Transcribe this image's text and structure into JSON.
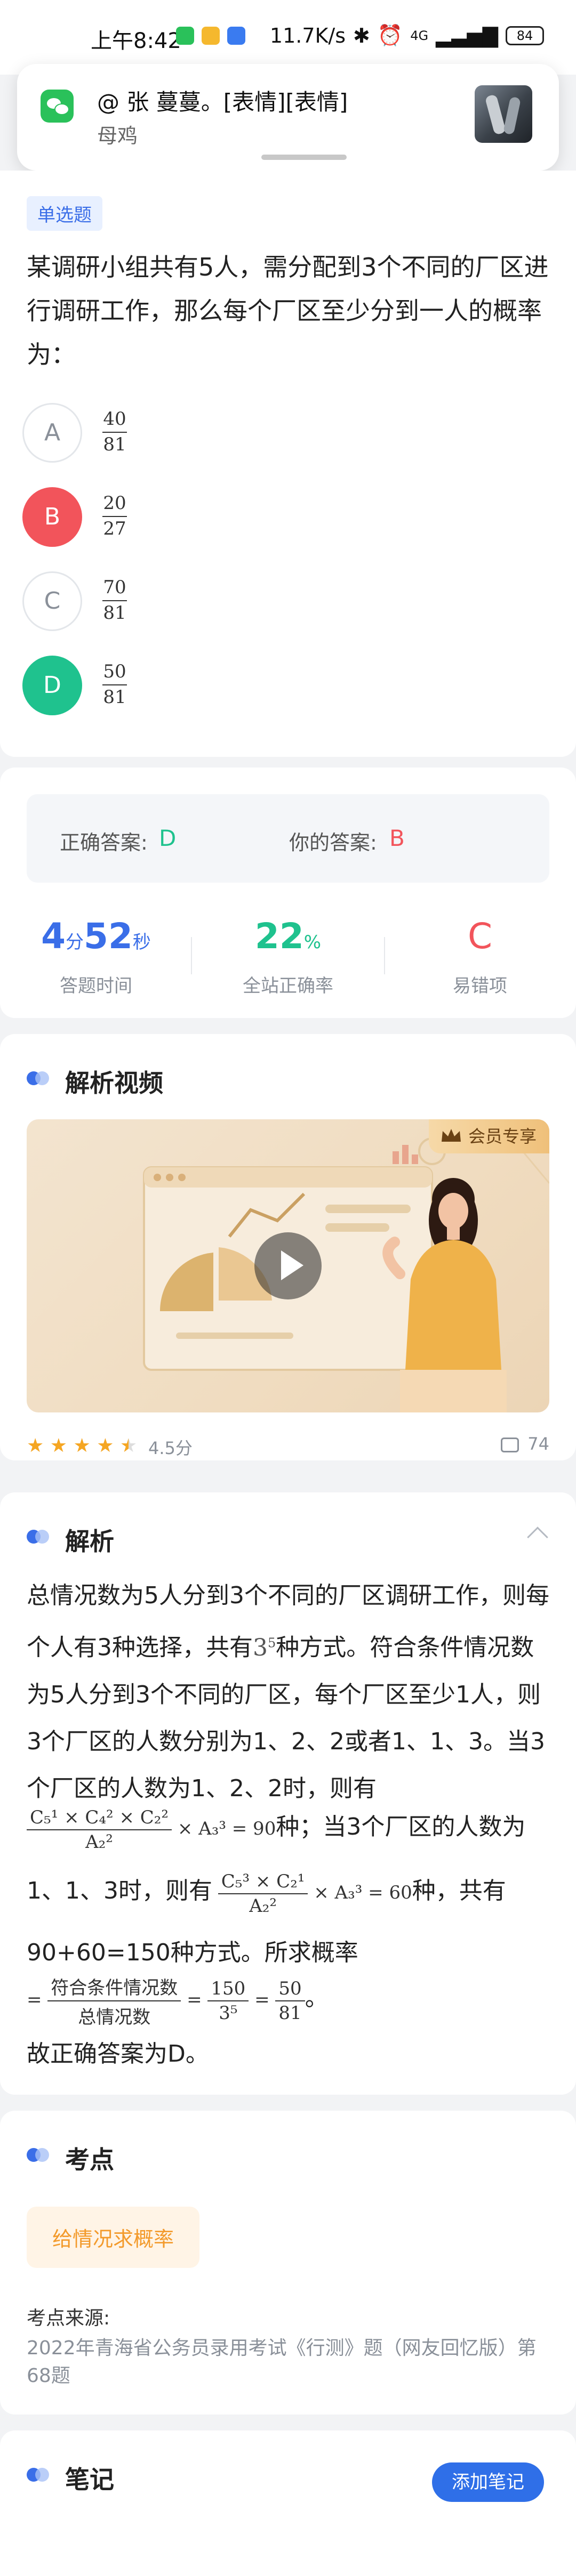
{
  "status_bar": {
    "time": "上午8:42",
    "net_speed": "11.7K/s",
    "network": "4G",
    "battery": "84"
  },
  "notification": {
    "app_icon": "wechat-icon",
    "title": "@ 张 蔓蔓。[表情][表情]",
    "body": "母鸡"
  },
  "question": {
    "type_badge": "单选题",
    "text": "某调研小组共有5人，需分配到3个不同的厂区进行调研工作，那么每个厂区至少分到一人的概率为：",
    "options": [
      {
        "letter": "A",
        "num": "40",
        "den": "81",
        "state": "default"
      },
      {
        "letter": "B",
        "num": "20",
        "den": "27",
        "state": "wrong"
      },
      {
        "letter": "C",
        "num": "70",
        "den": "81",
        "state": "default"
      },
      {
        "letter": "D",
        "num": "50",
        "den": "81",
        "state": "right"
      }
    ],
    "colors": {
      "correct": "#1fc28e",
      "wrong": "#f2545b"
    }
  },
  "answer": {
    "correct_label": "正确答案:",
    "correct_value": "D",
    "your_label": "你的答案:",
    "your_value": "B",
    "time_min": "4",
    "time_min_unit": "分",
    "time_sec": "52",
    "time_sec_unit": "秒",
    "time_label": "答题时间",
    "rate_value": "22",
    "rate_unit": "%",
    "rate_label": "全站正确率",
    "error_value": "C",
    "error_label": "易错项"
  },
  "video": {
    "section_title": "解析视频",
    "vip_tag": "会员专享",
    "rating_stars": 4.5,
    "rating_text": "4.5分",
    "comment_count": "74"
  },
  "explanation": {
    "section_title": "解析",
    "line1": "总情况数为5人分到3个不同的厂区调研工作，则每个人有3种选择，共有",
    "pow1": "3",
    "pow1_exp": "5",
    "line1_end": "种方式。符合条件情况数为5人分到3个不同的厂区，每个厂区至少1人，则3个厂区的人数分别为1、2、2或者1、1、3。当3个厂区的人数为1、2、2时，则有",
    "formula1_num": "C₅¹ × C₄² × C₂²",
    "formula1_den": "A₂²",
    "formula1_tail": "× A₃³ = 90",
    "mid1": "种；当3个厂区的人数为",
    "mid2": "1、1、3时，则有",
    "formula2_num": "C₅³ × C₂¹",
    "formula2_den": "A₂²",
    "formula2_tail": "× A₃³ = 60",
    "mid3": "种，共有",
    "line_sum": "90+60=150种方式。所求概率",
    "prob_num": "符合条件情况数",
    "prob_den": "总情况数",
    "prob_mid_num": "150",
    "prob_mid_den": "3⁵",
    "prob_res_num": "50",
    "prob_res_den": "81",
    "conclusion": "故正确答案为D。"
  },
  "key_point": {
    "section_title": "考点",
    "tag": "给情况求概率",
    "source_label": "考点来源:",
    "source": "2022年青海省公务员录用考试《行测》题（网友回忆版）第68题"
  },
  "notes": {
    "section_title": "笔记",
    "add_button": "添加笔记"
  }
}
